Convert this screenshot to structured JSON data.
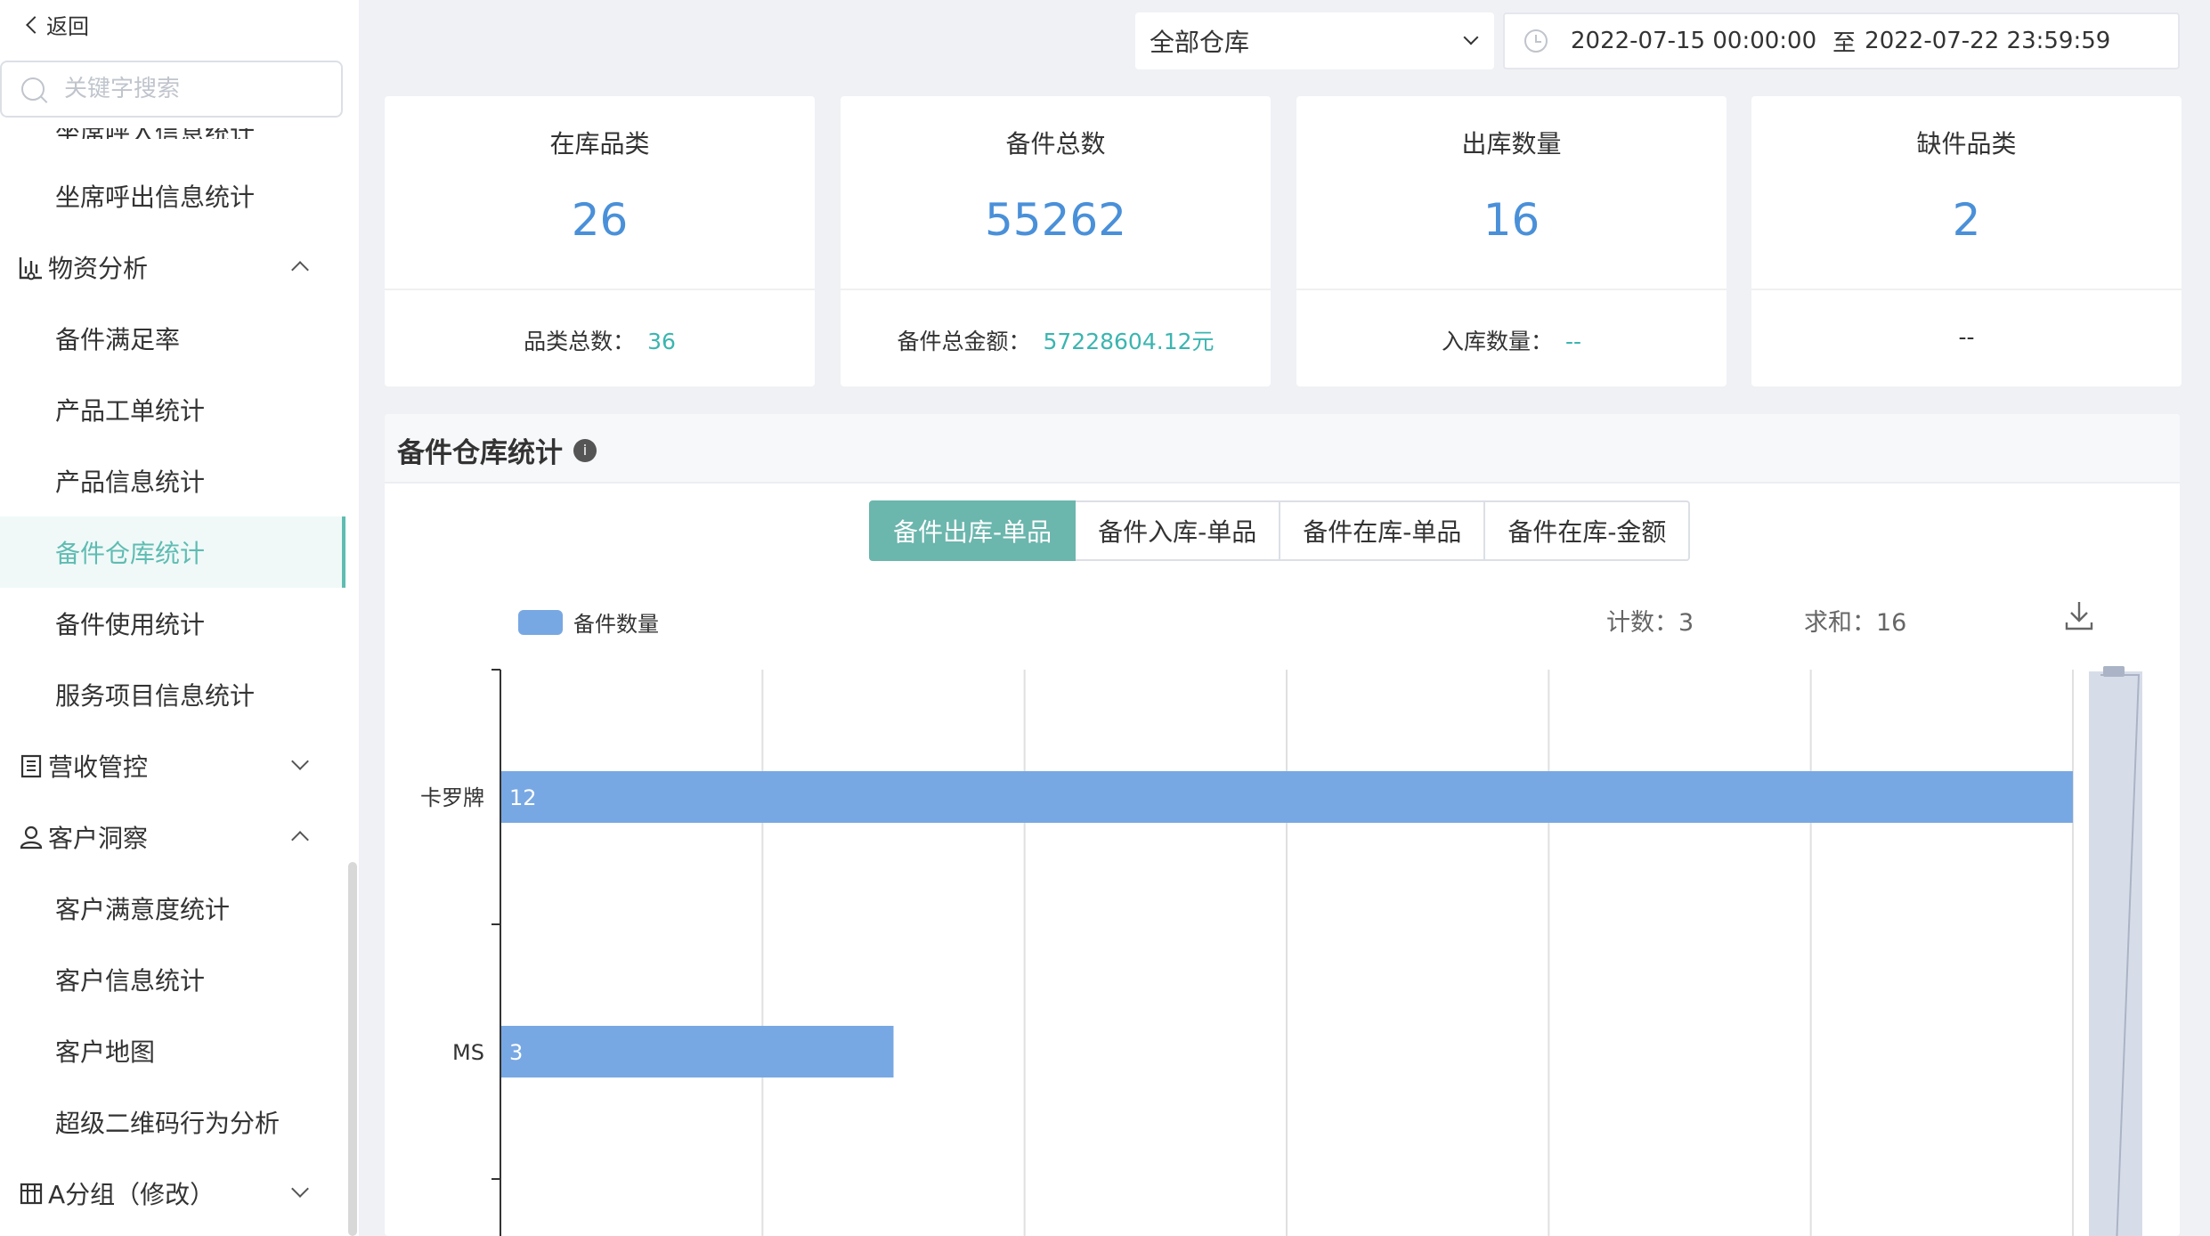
{
  "sidebar": {
    "back_label": "返回",
    "search_placeholder": "关键字搜索",
    "clipped_item": "坐席呼入信息统计",
    "items": [
      {
        "label": "坐席呼出信息统计"
      },
      {
        "label": "物资分析"
      },
      {
        "label": "备件满足率"
      },
      {
        "label": "产品工单统计"
      },
      {
        "label": "产品信息统计"
      },
      {
        "label": "备件仓库统计"
      },
      {
        "label": "备件使用统计"
      },
      {
        "label": "服务项目信息统计"
      },
      {
        "label": "营收管控"
      },
      {
        "label": "客户洞察"
      },
      {
        "label": "客户满意度统计"
      },
      {
        "label": "客户信息统计"
      },
      {
        "label": "客户地图"
      },
      {
        "label": "超级二维码行为分析"
      },
      {
        "label": "A分组（修改）"
      }
    ]
  },
  "filters": {
    "warehouse": "全部仓库",
    "date_start": "2022-07-15 00:00:00",
    "date_sep": "至",
    "date_end": "2022-07-22 23:59:59"
  },
  "cards": [
    {
      "title": "在库品类",
      "value": "26",
      "foot_label": "品类总数：",
      "foot_value": "36"
    },
    {
      "title": "备件总数",
      "value": "55262",
      "foot_label": "备件总金额：",
      "foot_value": "57228604.12元"
    },
    {
      "title": "出库数量",
      "value": "16",
      "foot_label": "入库数量：",
      "foot_value": "--"
    },
    {
      "title": "缺件品类",
      "value": "2",
      "foot_label": "",
      "foot_value": "--"
    }
  ],
  "panel": {
    "title": "备件仓库统计",
    "info_glyph": "i",
    "tabs": [
      "备件出库-单品",
      "备件入库-单品",
      "备件在库-单品",
      "备件在库-金额"
    ],
    "active_tab": 0,
    "count_text": "计数：3",
    "sum_text": "求和：16"
  },
  "chart_data": {
    "type": "bar",
    "orientation": "horizontal",
    "categories": [
      "卡罗牌",
      "MS"
    ],
    "series": [
      {
        "name": "备件数量",
        "values": [
          12,
          3
        ]
      }
    ],
    "color": "#78a8e3",
    "xlim": [
      0,
      12
    ],
    "grid": true,
    "legend": "top-left"
  }
}
